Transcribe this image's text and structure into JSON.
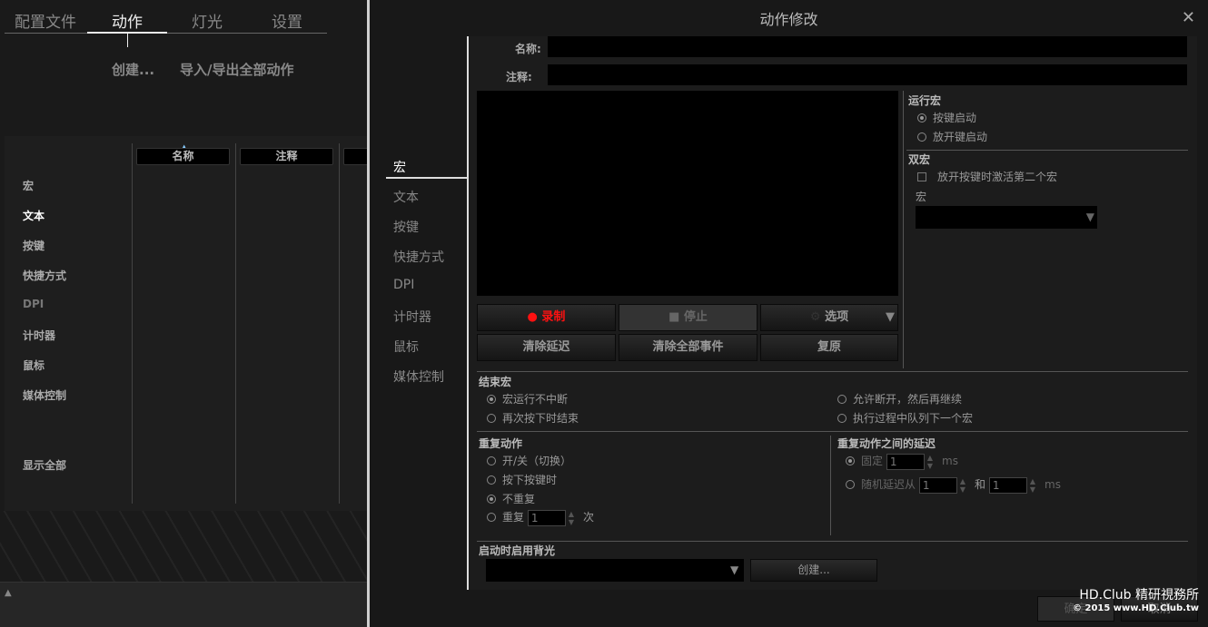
{
  "left": {
    "tabs": [
      "配置文件",
      "动作",
      "灯光",
      "设置"
    ],
    "active_tab": 1,
    "create": "创建...",
    "import_export": "导入/导出全部动作",
    "categories": [
      "宏",
      "文本",
      "按键",
      "快捷方式",
      "DPI",
      "计时器",
      "鼠标",
      "媒体控制"
    ],
    "active_category": 1,
    "show_all": "显示全部",
    "columns": [
      "名称",
      "注释"
    ]
  },
  "dialog": {
    "title": "动作修改",
    "close": "✕",
    "side": [
      "宏",
      "文本",
      "按键",
      "快捷方式",
      "DPI",
      "计时器",
      "鼠标",
      "媒体控制"
    ],
    "active_side": 0,
    "name_label": "名称:",
    "name_value": "",
    "note_label": "注释:",
    "note_value": "",
    "record": "录制",
    "stop": "停止",
    "options": "选项",
    "clear_delay": "清除延迟",
    "clear_all": "清除全部事件",
    "restore": "复原",
    "run_macro": {
      "title": "运行宏",
      "options": [
        "按键启动",
        "放开键启动"
      ],
      "selected": 0
    },
    "dual_macro": {
      "title": "双宏",
      "checkbox": "放开按键时激活第二个宏",
      "checked": false,
      "macro_label": "宏",
      "macro_value": ""
    },
    "end_macro": {
      "title": "结束宏",
      "options": [
        "宏运行不中断",
        "再次按下时结束",
        "允许断开，然后再继续",
        "执行过程中队列下一个宏"
      ],
      "selected": 0
    },
    "repeat": {
      "title": "重复动作",
      "options": [
        "开/关（切换）",
        "按下按键时",
        "不重复",
        "重复"
      ],
      "selected": 2,
      "count": "1",
      "times": "次"
    },
    "repeat_delay": {
      "title": "重复动作之间的延迟",
      "fixed": "固定",
      "fixed_value": "1",
      "unit": "ms",
      "random": "随机延迟从",
      "random_from": "1",
      "and": "和",
      "random_to": "1",
      "selected": 0
    },
    "backlight": {
      "title": "启动时启用背光",
      "value": "",
      "create": "创建..."
    },
    "ok": "确定",
    "cancel": "取消"
  },
  "watermark": {
    "line1": "HD.Club 精研視務所",
    "line2": "© 2015  www.HD.Club.tw"
  },
  "colors": {
    "record": "#ff1a1a"
  }
}
